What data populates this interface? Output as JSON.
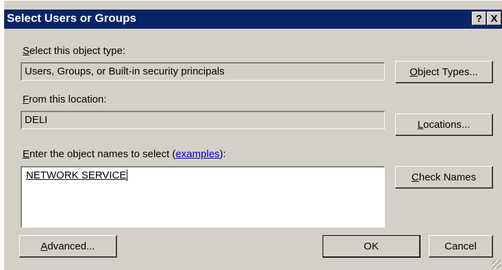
{
  "window": {
    "title": "Select Users or Groups",
    "help_glyph": "?",
    "close_glyph": "X"
  },
  "object_type": {
    "label_u": "S",
    "label_rest": "elect this object type:",
    "value": "Users, Groups, or Built-in security principals",
    "button_u": "O",
    "button_rest": "bject Types..."
  },
  "location": {
    "label_u": "F",
    "label_rest": "rom this location:",
    "value": "DELI",
    "button_u": "L",
    "button_rest": "ocations..."
  },
  "names": {
    "label_u": "E",
    "label_rest": "nter the object names to select (",
    "label_link": "examples",
    "label_end": "):",
    "value": "NETWORK SERVICE",
    "check_button_u": "C",
    "check_button_rest": "heck Names"
  },
  "footer": {
    "advanced_u": "A",
    "advanced_rest": "dvanced...",
    "ok_label": "OK",
    "cancel_label": "Cancel"
  },
  "colors": {
    "titlebar": "#0a246a",
    "face": "#d4d0c8",
    "link": "#0000cc"
  }
}
